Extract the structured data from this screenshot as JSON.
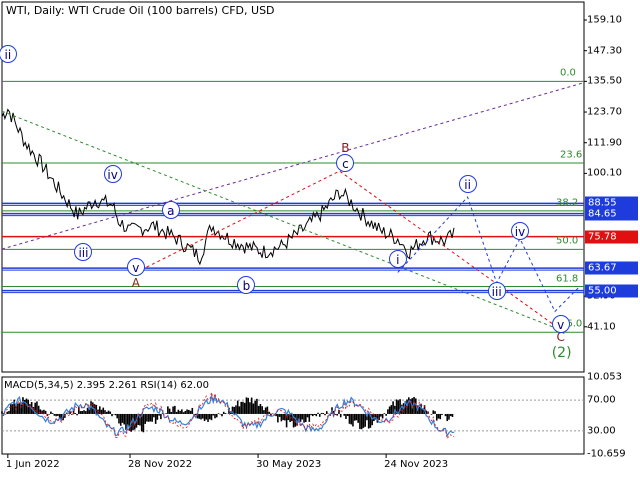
{
  "title": "WTI, Daily:  WTI Crude Oil (100 barrels) CFD, USD",
  "indicator_label": "MACD(5,34,5) 2.395 2.261 RSI(14) 62.00",
  "colors": {
    "blue": "#1e3cdc",
    "red": "#e01010",
    "green": "#2e8b2e",
    "navy": "#000080",
    "dark_red": "#8b1a1a",
    "grid": "#000000"
  },
  "price_axis": [
    {
      "label": "159.10",
      "v": 159.1
    },
    {
      "label": "147.30",
      "v": 147.3
    },
    {
      "label": "135.50",
      "v": 135.5
    },
    {
      "label": "123.70",
      "v": 123.7
    },
    {
      "label": "111.90",
      "v": 111.9
    },
    {
      "label": "100.10",
      "v": 100.1
    },
    {
      "label": "52.90",
      "v": 52.9
    },
    {
      "label": "41.10",
      "v": 41.1
    }
  ],
  "price_tags": [
    {
      "label": "88.55",
      "v": 88.55,
      "color": "#1e3cdc"
    },
    {
      "label": "84.65",
      "v": 84.65,
      "color": "#1e3cdc"
    },
    {
      "label": "75.78",
      "v": 75.78,
      "color": "#e01010"
    },
    {
      "label": "63.67",
      "v": 63.67,
      "color": "#1e3cdc"
    },
    {
      "label": "55.00",
      "v": 55.0,
      "color": "#1e3cdc"
    }
  ],
  "fib_levels": [
    {
      "label": "0.0",
      "v": 135.5
    },
    {
      "label": "23.6",
      "v": 104.1
    },
    {
      "label": "38.2",
      "v": 85.7
    },
    {
      "label": "50.0",
      "v": 70.9
    },
    {
      "label": "61.8",
      "v": 56.6
    },
    {
      "label": "76.0",
      "v": 39.0
    }
  ],
  "indicator_axis": [
    {
      "label": "10.053",
      "v": 100
    },
    {
      "label": "70.00",
      "v": 70
    },
    {
      "label": "30.00",
      "v": 30
    },
    {
      "label": "-10.659",
      "v": 0
    }
  ],
  "x_axis": [
    {
      "label": "1 Jun 2022",
      "t": 0.01
    },
    {
      "label": "28 Nov 2022",
      "t": 0.22
    },
    {
      "label": "30 May 2023",
      "t": 0.44
    },
    {
      "label": "24 Nov 2023",
      "t": 0.66
    }
  ],
  "wave_labels": [
    {
      "text": "ii",
      "style": "circle-blue"
    },
    {
      "text": "iii",
      "style": "circle-blue"
    },
    {
      "text": "iv",
      "style": "circle-blue"
    },
    {
      "text": "v",
      "style": "circle-blue"
    },
    {
      "text": "a",
      "style": "circle-blue"
    },
    {
      "text": "b",
      "style": "circle-blue"
    },
    {
      "text": "c",
      "style": "circle-blue"
    },
    {
      "text": "A",
      "style": "red"
    },
    {
      "text": "B",
      "style": "red"
    },
    {
      "text": "C",
      "style": "red"
    },
    {
      "text": "i",
      "style": "circle-blue"
    },
    {
      "text": "ii",
      "style": "circle-blue"
    },
    {
      "text": "iii",
      "style": "circle-blue"
    },
    {
      "text": "iv",
      "style": "circle-blue"
    },
    {
      "text": "v",
      "style": "circle-blue"
    },
    {
      "text": "(2)",
      "style": "green"
    }
  ]
}
